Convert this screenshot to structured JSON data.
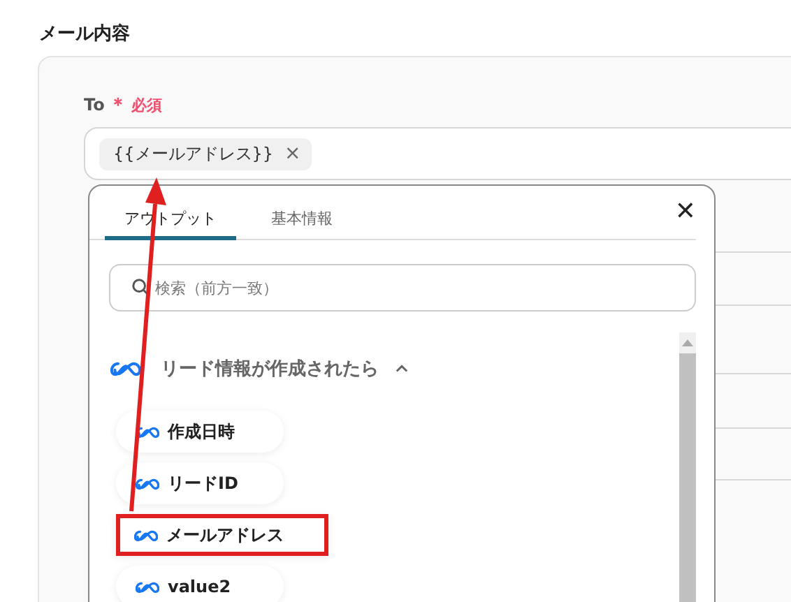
{
  "section_title": "メール内容",
  "field": {
    "label": "To",
    "required_mark": "＊",
    "required_text": "必須",
    "chips": [
      {
        "text": "{{メールアドレス}}",
        "remove": "×"
      }
    ]
  },
  "popup": {
    "close": "✕",
    "tabs": [
      {
        "label": "アウトプット",
        "selected": true
      },
      {
        "label": "基本情報",
        "selected": false
      }
    ],
    "search": {
      "placeholder": "検索（前方一致）"
    },
    "group": {
      "title": "リード情報が作成されたら",
      "expanded": true,
      "items": [
        {
          "label": "作成日時",
          "highlighted": false
        },
        {
          "label": "リードID",
          "highlighted": false
        },
        {
          "label": "メールアドレス",
          "highlighted": true
        },
        {
          "label": "value2",
          "highlighted": false
        }
      ]
    }
  }
}
